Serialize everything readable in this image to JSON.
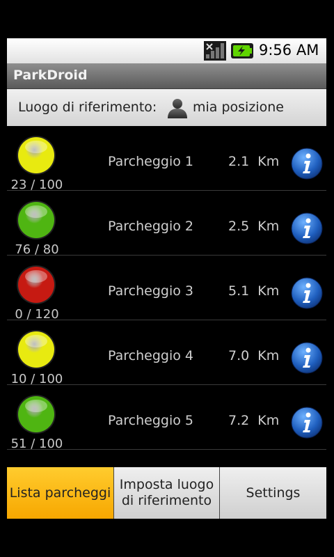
{
  "status_bar": {
    "time": "9:56 AM",
    "icons": [
      "signal-icon",
      "battery-charging-icon"
    ]
  },
  "title_bar": {
    "title": "ParkDroid"
  },
  "reference": {
    "label": "Luogo di riferimento:",
    "icon": "person-icon",
    "value": "mia posizione"
  },
  "parkings": [
    {
      "name": "Parcheggio 1",
      "distance": "2.1  Km",
      "count": "23 / 100",
      "status": "yellow",
      "light_color": "#e8ea10",
      "info_icon": "info-icon"
    },
    {
      "name": "Parcheggio 2",
      "distance": "2.5  Km",
      "count": "76 / 80",
      "status": "green",
      "light_color": "#4fb512",
      "info_icon": "info-icon"
    },
    {
      "name": "Parcheggio 3",
      "distance": "5.1  Km",
      "count": "0 / 120",
      "status": "red",
      "light_color": "#c61a12",
      "info_icon": "info-icon"
    },
    {
      "name": "Parcheggio 4",
      "distance": "7.0  Km",
      "count": "10 / 100",
      "status": "yellow",
      "light_color": "#e8ea10",
      "info_icon": "info-icon"
    },
    {
      "name": "Parcheggio 5",
      "distance": "7.2  Km",
      "count": "51 / 100",
      "status": "green",
      "light_color": "#4fb512",
      "info_icon": "info-icon"
    }
  ],
  "tabs": [
    {
      "label": "Lista parcheggi",
      "selected": true
    },
    {
      "label": "Imposta luogo di riferimento",
      "selected": false
    },
    {
      "label": "Settings",
      "selected": false
    }
  ],
  "colors": {
    "tab_selected": "#ffbb00",
    "info_blue": "#1f5fbf"
  }
}
